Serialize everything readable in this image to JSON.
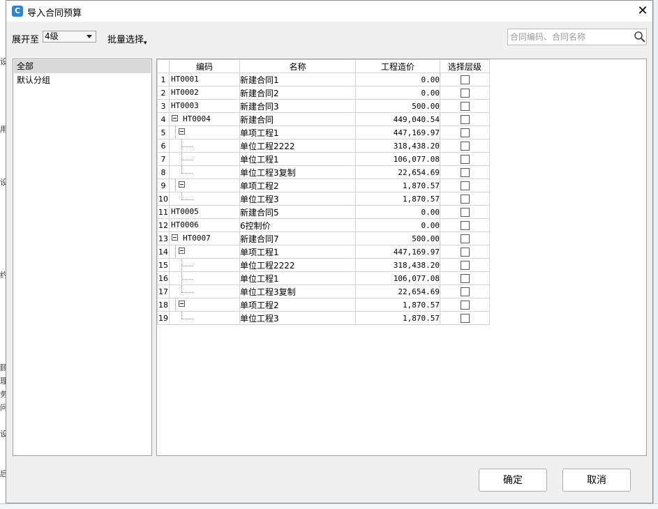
{
  "dialog": {
    "title": "导入合同预算",
    "app_icon": "glodon-logo-icon",
    "close_glyph": "✕"
  },
  "toolbar": {
    "expand_label": "展开至",
    "level_value": "4级",
    "batch_select_label": "批量选择"
  },
  "search": {
    "placeholder": "合同编码、合同名称"
  },
  "groups": [
    {
      "label": "全部",
      "selected": true
    },
    {
      "label": "默认分组",
      "selected": false
    }
  ],
  "grid": {
    "columns": [
      "编码",
      "名称",
      "工程造价",
      "选择层级"
    ],
    "rows": [
      {
        "no": "1",
        "code": "HT0001",
        "name": "新建合同1",
        "price": "0.00",
        "level": 0
      },
      {
        "no": "2",
        "code": "HT0002",
        "name": "新建合同2",
        "price": "0.00",
        "level": 0
      },
      {
        "no": "3",
        "code": "HT0003",
        "name": "新建合同3",
        "price": "500.00",
        "level": 0
      },
      {
        "no": "4",
        "code": "HT0004",
        "name": "新建合同",
        "price": "449,040.54",
        "level": 0,
        "expander": true
      },
      {
        "no": "5",
        "code": "",
        "name": "单项工程1",
        "price": "447,169.97",
        "level": 1,
        "expander": true
      },
      {
        "no": "6",
        "code": "",
        "name": "单位工程2222",
        "price": "318,438.20",
        "level": 2
      },
      {
        "no": "7",
        "code": "",
        "name": "单位工程1",
        "price": "106,077.08",
        "level": 2
      },
      {
        "no": "8",
        "code": "",
        "name": "单位工程3复制",
        "price": "22,654.69",
        "level": 2,
        "last": true
      },
      {
        "no": "9",
        "code": "",
        "name": "单项工程2",
        "price": "1,870.57",
        "level": 1,
        "expander": true
      },
      {
        "no": "10",
        "code": "",
        "name": "单位工程3",
        "price": "1,870.57",
        "level": 2,
        "last": true
      },
      {
        "no": "11",
        "code": "HT0005",
        "name": "新建合同5",
        "price": "0.00",
        "level": 0
      },
      {
        "no": "12",
        "code": "HT0006",
        "name": "6控制价",
        "price": "0.00",
        "level": 0
      },
      {
        "no": "13",
        "code": "HT0007",
        "name": "新建合同7",
        "price": "500.00",
        "level": 0,
        "expander": true
      },
      {
        "no": "14",
        "code": "",
        "name": "单项工程1",
        "price": "447,169.97",
        "level": 1,
        "expander": true
      },
      {
        "no": "15",
        "code": "",
        "name": "单位工程2222",
        "price": "318,438.20",
        "level": 2
      },
      {
        "no": "16",
        "code": "",
        "name": "单位工程1",
        "price": "106,077.08",
        "level": 2
      },
      {
        "no": "17",
        "code": "",
        "name": "单位工程3复制",
        "price": "22,654.69",
        "level": 2,
        "last": true
      },
      {
        "no": "18",
        "code": "",
        "name": "单项工程2",
        "price": "1,870.57",
        "level": 1,
        "expander": true
      },
      {
        "no": "19",
        "code": "",
        "name": "单位工程3",
        "price": "1,870.57",
        "level": 2,
        "last": true
      }
    ]
  },
  "footer": {
    "ok_label": "确定",
    "cancel_label": "取消"
  },
  "background_app": {
    "edge_glyphs": [
      "设",
      "用",
      "设",
      "约",
      "顾",
      "理",
      "务",
      "问",
      "设",
      "后"
    ]
  }
}
